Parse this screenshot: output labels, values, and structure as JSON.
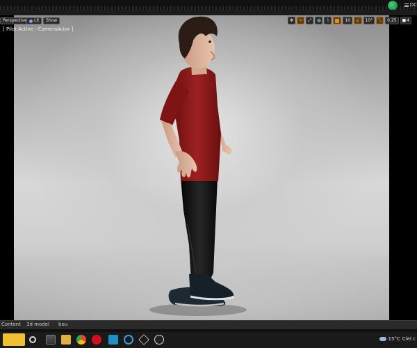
{
  "top_bar": {
    "menu_label": "DC"
  },
  "viewport": {
    "perspective_label": "Perspective",
    "lit_label": "Lit",
    "show_label": "Show",
    "pilot_text": "[ Pilot Active - CameraActor ]",
    "grid_snap_value": "10",
    "rotation_snap_value": "10°",
    "scale_snap_value": "0.25",
    "camera_speed_value": "4"
  },
  "taskbar": {
    "strip_items": [
      "Content",
      "3d model",
      "bou"
    ],
    "weather_temp": "15°C",
    "weather_desc": "Ciel c"
  },
  "colors": {
    "accent": "#d6922e",
    "shirt": "#8e1a1a",
    "pants": "#121212",
    "viewport_bg": "#c8c8c8"
  }
}
